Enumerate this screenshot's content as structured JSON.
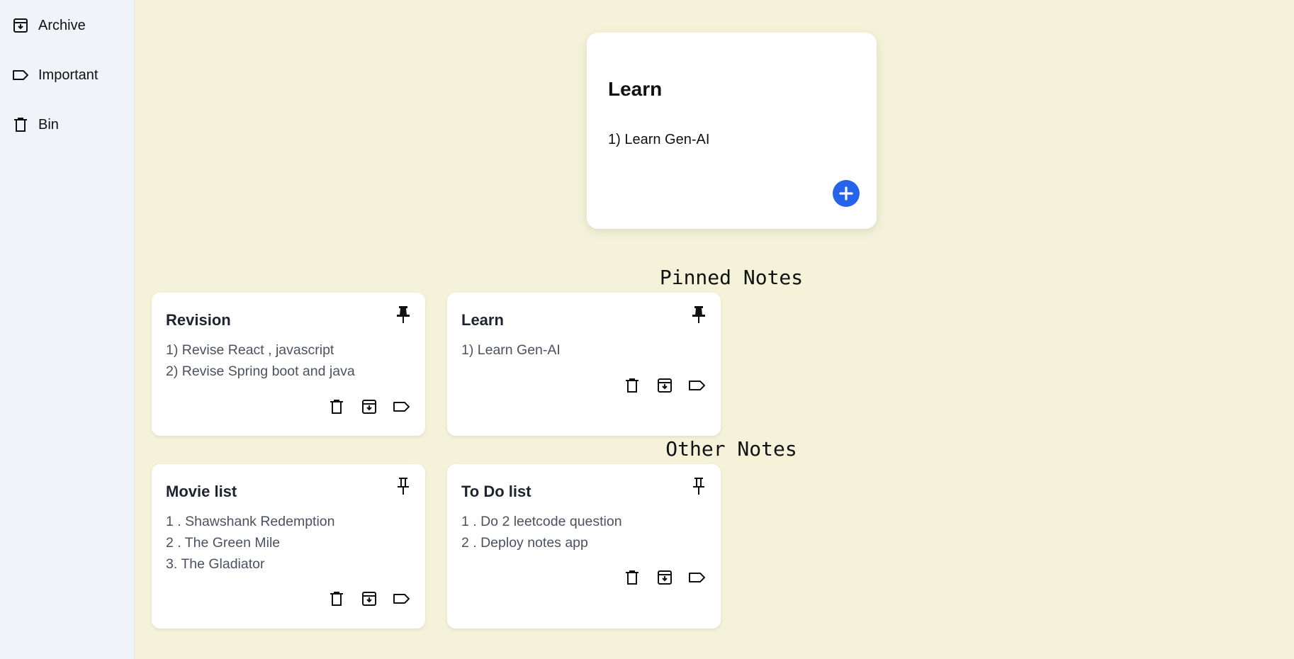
{
  "sidebar": {
    "items": [
      {
        "label": "Archive",
        "icon": "archive-icon"
      },
      {
        "label": "Important",
        "icon": "label-icon"
      },
      {
        "label": "Bin",
        "icon": "trash-icon"
      }
    ]
  },
  "composer": {
    "title": "Learn",
    "body": "1) Learn Gen-AI",
    "add_icon": "plus-icon",
    "accent_color": "#2563eb"
  },
  "sections": {
    "pinned_heading": "Pinned Notes",
    "other_heading": "Other Notes"
  },
  "pinned_notes": [
    {
      "title": "Revision",
      "lines": [
        "1) Revise React , javascript",
        "2) Revise Spring boot and java"
      ],
      "pinned": true
    },
    {
      "title": "Learn",
      "lines": [
        "1) Learn Gen-AI"
      ],
      "pinned": true
    }
  ],
  "other_notes": [
    {
      "title": "Movie list",
      "lines": [
        "1 . Shawshank Redemption",
        "2 . The Green Mile",
        "3. The Gladiator"
      ],
      "pinned": false
    },
    {
      "title": "To Do list",
      "lines": [
        "1 . Do 2 leetcode question",
        "2 . Deploy notes app"
      ],
      "pinned": false
    }
  ],
  "note_action_icons": [
    "trash-icon",
    "archive-icon",
    "label-icon"
  ],
  "colors": {
    "background": "#f4f3d9",
    "sidebar": "#f0f3f8",
    "card": "#ffffff"
  }
}
